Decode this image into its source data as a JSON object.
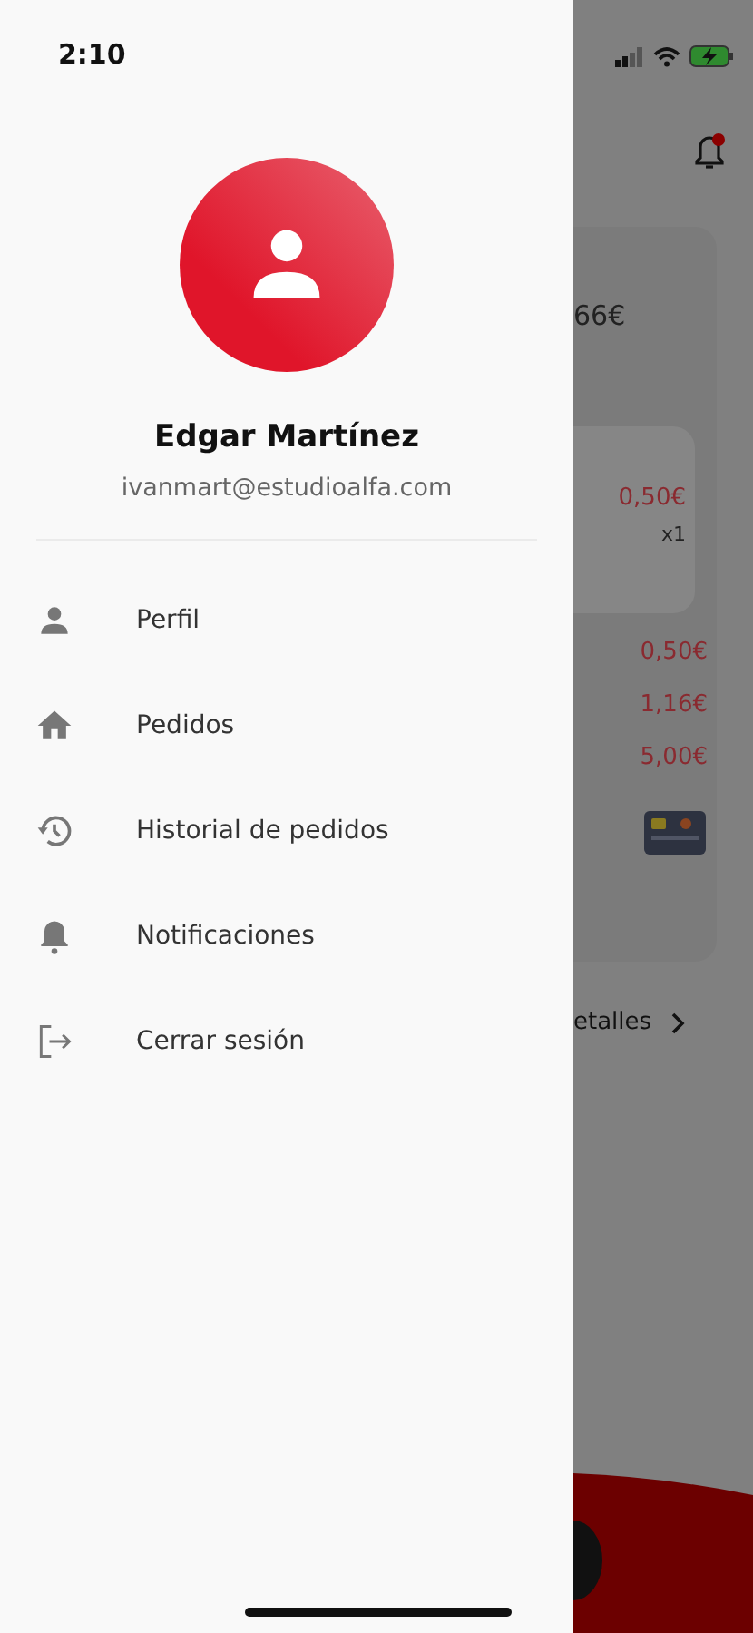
{
  "status_bar": {
    "time": "2:10"
  },
  "drawer": {
    "user": {
      "name": "Edgar Martínez",
      "email": "ivanmart@estudioalfa.com"
    },
    "menu": [
      {
        "label": "Perfil"
      },
      {
        "label": "Pedidos"
      },
      {
        "label": "Historial de pedidos"
      },
      {
        "label": "Notificaciones"
      },
      {
        "label": "Cerrar sesión"
      }
    ]
  },
  "background": {
    "notifications": {
      "unread": true
    },
    "order_total": "66€",
    "item": {
      "price": "0,50€",
      "quantity": "x1"
    },
    "amounts": [
      "0,50€",
      "1,16€",
      "5,00€"
    ],
    "details_link": "etalles"
  }
}
